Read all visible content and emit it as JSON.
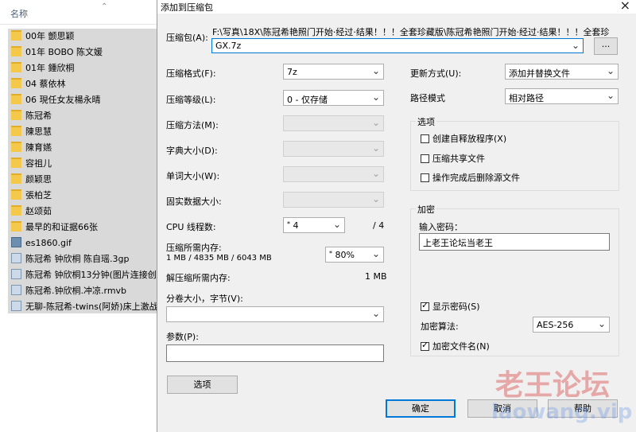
{
  "explorer": {
    "column_header": "名称",
    "items": [
      {
        "name": "00年 颤思颖",
        "type": "folder"
      },
      {
        "name": "01年 BOBO 陈文媛",
        "type": "folder"
      },
      {
        "name": "01年 鍾欣桐",
        "type": "folder"
      },
      {
        "name": "04 蔡依林",
        "type": "folder"
      },
      {
        "name": "06 現任女友楊永晴",
        "type": "folder"
      },
      {
        "name": "陈冠希",
        "type": "folder"
      },
      {
        "name": "陳思慧",
        "type": "folder"
      },
      {
        "name": "陳育嬿",
        "type": "folder"
      },
      {
        "name": "容祖儿",
        "type": "folder"
      },
      {
        "name": "颜颖思",
        "type": "folder"
      },
      {
        "name": "張柏芝",
        "type": "folder"
      },
      {
        "name": "赵颂茹",
        "type": "folder"
      },
      {
        "name": "最早的和证据66张",
        "type": "folder"
      },
      {
        "name": "es1860.gif",
        "type": "gif"
      },
      {
        "name": "陈冠希 钟欣桐 陈自瑶.3gp",
        "type": "video"
      },
      {
        "name": "陈冠希 钟欣桐13分钟(图片连接创",
        "type": "video"
      },
      {
        "name": "陈冠希.钟欣桐.冲凉.rmvb",
        "type": "video"
      },
      {
        "name": "无聊-陈冠希-twins(阿娇)床上激战",
        "type": "video"
      }
    ]
  },
  "dialog": {
    "title": "添加到压缩包",
    "close_icon": "×",
    "archive_label": "压缩包(A):",
    "archive_path": "F:\\写真\\18X\\陈冠希艳照门开始·经过·结果！！！全套珍藏版\\陈冠希艳照门开始·经过·结果！！！全套珍",
    "archive_name": "GX.7z",
    "browse_label": "...",
    "format_label": "压缩格式(F):",
    "format_value": "7z",
    "level_label": "压缩等级(L):",
    "level_value": "0 - 仅存储",
    "method_label": "压缩方法(M):",
    "dict_label": "字典大小(D):",
    "word_label": "单词大小(W):",
    "solid_label": "固实数据大小:",
    "cpu_label": "CPU 线程数:",
    "cpu_value": "4",
    "cpu_total": "/ 4",
    "mem_comp_label": "压缩所需内存:",
    "mem_comp_detail": "1 MB / 4835 MB / 6043 MB",
    "mem_comp_pct": "80%",
    "mem_decomp_label": "解压缩所需内存:",
    "mem_decomp_value": "1 MB",
    "split_label": "分卷大小，字节(V):",
    "params_label": "参数(P):",
    "options_button": "选项",
    "update_label": "更新方式(U):",
    "update_value": "添加并替换文件",
    "pathmode_label": "路径模式",
    "pathmode_value": "相对路径",
    "options_group": "选项",
    "opt_sfx": "创建自释放程序(X)",
    "opt_shared": "压缩共享文件",
    "opt_delete": "操作完成后删除源文件",
    "encrypt_group": "加密",
    "password_label": "输入密码：",
    "password_value": "上老王论坛当老王",
    "show_password": "显示密码(S)",
    "enc_method_label": "加密算法:",
    "enc_method_value": "AES-256",
    "enc_names": "加密文件名(N)",
    "ok_button": "确定",
    "cancel_button": "取消",
    "help_button": "帮助"
  },
  "watermark": {
    "text": "老王论坛",
    "url": "laowang.vip"
  }
}
